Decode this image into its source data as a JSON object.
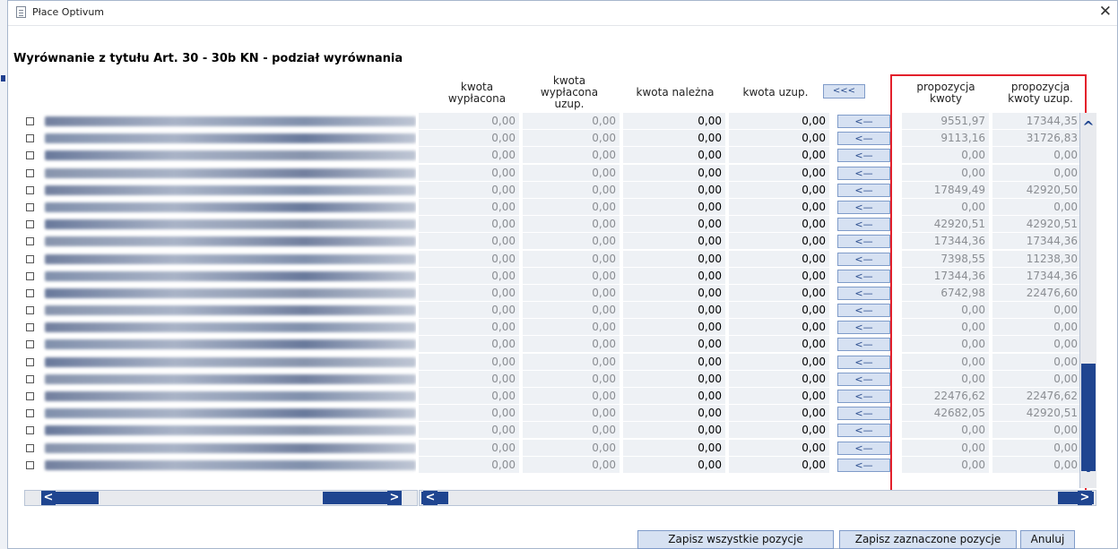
{
  "window": {
    "title": "Płace Optivum",
    "close_glyph": "✕"
  },
  "heading": "Wyrównanie z tytułu Art. 30 - 30b KN - podział wyrównania",
  "columns": {
    "kwota_wyplacona": "kwota\nwypłacona",
    "kwota_wyplacona_uzup": "kwota\nwypłacona\nuzup.",
    "kwota_nalezna": "kwota należna",
    "kwota_uzup": "kwota uzup.",
    "apply_all_glyph": "<<<",
    "propozycja_kwoty": "propozycja\nkwoty",
    "propozycja_kwoty_uzup": "propozycja\nkwoty uzup."
  },
  "row_arrow_glyph": "<—",
  "rows": [
    {
      "k1": "0,00",
      "k2": "0,00",
      "k3": "0,00",
      "k4": "0,00",
      "p1": "9551,97",
      "p2": "17344,35"
    },
    {
      "k1": "0,00",
      "k2": "0,00",
      "k3": "0,00",
      "k4": "0,00",
      "p1": "9113,16",
      "p2": "31726,83"
    },
    {
      "k1": "0,00",
      "k2": "0,00",
      "k3": "0,00",
      "k4": "0,00",
      "p1": "0,00",
      "p2": "0,00"
    },
    {
      "k1": "0,00",
      "k2": "0,00",
      "k3": "0,00",
      "k4": "0,00",
      "p1": "0,00",
      "p2": "0,00"
    },
    {
      "k1": "0,00",
      "k2": "0,00",
      "k3": "0,00",
      "k4": "0,00",
      "p1": "17849,49",
      "p2": "42920,50"
    },
    {
      "k1": "0,00",
      "k2": "0,00",
      "k3": "0,00",
      "k4": "0,00",
      "p1": "0,00",
      "p2": "0,00"
    },
    {
      "k1": "0,00",
      "k2": "0,00",
      "k3": "0,00",
      "k4": "0,00",
      "p1": "42920,51",
      "p2": "42920,51"
    },
    {
      "k1": "0,00",
      "k2": "0,00",
      "k3": "0,00",
      "k4": "0,00",
      "p1": "17344,36",
      "p2": "17344,36"
    },
    {
      "k1": "0,00",
      "k2": "0,00",
      "k3": "0,00",
      "k4": "0,00",
      "p1": "7398,55",
      "p2": "11238,30"
    },
    {
      "k1": "0,00",
      "k2": "0,00",
      "k3": "0,00",
      "k4": "0,00",
      "p1": "17344,36",
      "p2": "17344,36"
    },
    {
      "k1": "0,00",
      "k2": "0,00",
      "k3": "0,00",
      "k4": "0,00",
      "p1": "6742,98",
      "p2": "22476,60"
    },
    {
      "k1": "0,00",
      "k2": "0,00",
      "k3": "0,00",
      "k4": "0,00",
      "p1": "0,00",
      "p2": "0,00"
    },
    {
      "k1": "0,00",
      "k2": "0,00",
      "k3": "0,00",
      "k4": "0,00",
      "p1": "0,00",
      "p2": "0,00"
    },
    {
      "k1": "0,00",
      "k2": "0,00",
      "k3": "0,00",
      "k4": "0,00",
      "p1": "0,00",
      "p2": "0,00"
    },
    {
      "k1": "0,00",
      "k2": "0,00",
      "k3": "0,00",
      "k4": "0,00",
      "p1": "0,00",
      "p2": "0,00"
    },
    {
      "k1": "0,00",
      "k2": "0,00",
      "k3": "0,00",
      "k4": "0,00",
      "p1": "0,00",
      "p2": "0,00"
    },
    {
      "k1": "0,00",
      "k2": "0,00",
      "k3": "0,00",
      "k4": "0,00",
      "p1": "22476,62",
      "p2": "22476,62"
    },
    {
      "k1": "0,00",
      "k2": "0,00",
      "k3": "0,00",
      "k4": "0,00",
      "p1": "42682,05",
      "p2": "42920,51"
    },
    {
      "k1": "0,00",
      "k2": "0,00",
      "k3": "0,00",
      "k4": "0,00",
      "p1": "0,00",
      "p2": "0,00"
    },
    {
      "k1": "0,00",
      "k2": "0,00",
      "k3": "0,00",
      "k4": "0,00",
      "p1": "0,00",
      "p2": "0,00"
    },
    {
      "k1": "0,00",
      "k2": "0,00",
      "k3": "0,00",
      "k4": "0,00",
      "p1": "0,00",
      "p2": "0,00"
    }
  ],
  "buttons": {
    "save_all": "Zapisz wszystkie pozycje",
    "save_selected": "Zapisz zaznaczone pozycje",
    "cancel": "Anuluj"
  },
  "colors": {
    "accent": "#1f4590",
    "highlight_box": "#e3202b",
    "button_bg": "#d6e1f2"
  }
}
